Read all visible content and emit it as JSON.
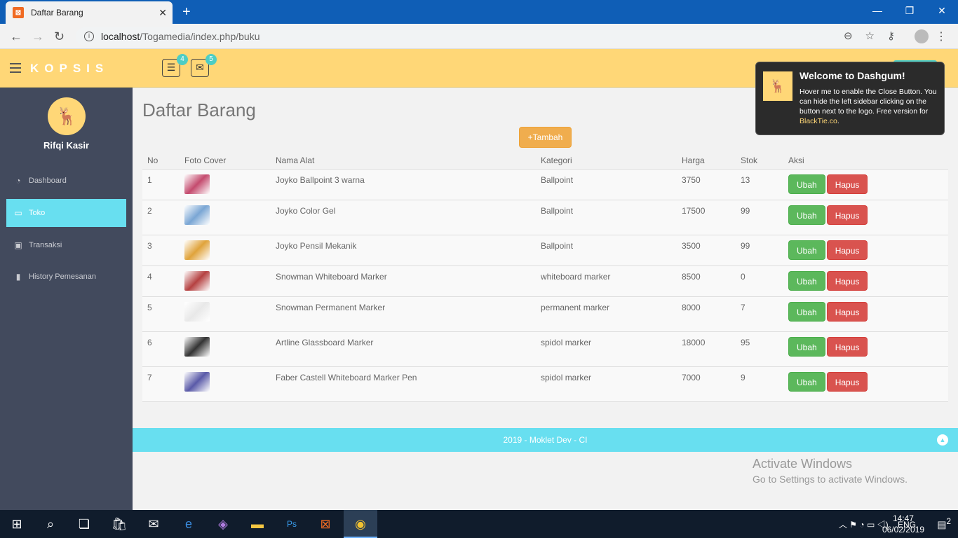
{
  "browser": {
    "tab_title": "Daftar Barang",
    "url_host": "localhost",
    "url_path": "/Togamedia/index.php/buku"
  },
  "header": {
    "logo": "KOPSIS",
    "badge_tasks": "4",
    "badge_mail": "5"
  },
  "sidebar": {
    "username": "Rifqi Kasir",
    "items": [
      {
        "label": "Dashboard",
        "icon": "dashboard-icon"
      },
      {
        "label": "Toko",
        "icon": "desktop-icon"
      },
      {
        "label": "Transaksi",
        "icon": "money-icon"
      },
      {
        "label": "History Pemesanan",
        "icon": "bookmark-icon"
      }
    ]
  },
  "main": {
    "title": "Daftar Barang",
    "add_button": "+Tambah",
    "columns": [
      "No",
      "Foto Cover",
      "Nama Alat",
      "Kategori",
      "Harga",
      "Stok",
      "Aksi"
    ],
    "edit_label": "Ubah",
    "delete_label": "Hapus",
    "rows": [
      {
        "no": "1",
        "nama": "Joyko Ballpoint 3 warna",
        "kategori": "Ballpoint",
        "harga": "3750",
        "stok": "13",
        "thumb": "#c44b6e"
      },
      {
        "no": "2",
        "nama": "Joyko Color Gel",
        "kategori": "Ballpoint",
        "harga": "17500",
        "stok": "99",
        "thumb": "#7aa6d4"
      },
      {
        "no": "3",
        "nama": "Joyko Pensil Mekanik",
        "kategori": "Ballpoint",
        "harga": "3500",
        "stok": "99",
        "thumb": "#e0a33b"
      },
      {
        "no": "4",
        "nama": "Snowman Whiteboard Marker",
        "kategori": "whiteboard marker",
        "harga": "8500",
        "stok": "0",
        "thumb": "#b54141"
      },
      {
        "no": "5",
        "nama": "Snowman Permanent Marker",
        "kategori": "permanent marker",
        "harga": "8000",
        "stok": "7",
        "thumb": "#e8e8e8"
      },
      {
        "no": "6",
        "nama": "Artline Glassboard Marker",
        "kategori": "spidol marker",
        "harga": "18000",
        "stok": "95",
        "thumb": "#333333"
      },
      {
        "no": "7",
        "nama": "Faber Castell Whiteboard Marker Pen",
        "kategori": "spidol marker",
        "harga": "7000",
        "stok": "9",
        "thumb": "#5a5aa8"
      }
    ]
  },
  "footer": {
    "text": "2019 - Moklet Dev - CI"
  },
  "toast": {
    "title": "Welcome to Dashgum!",
    "body": "Hover me to enable the Close Button. You can hide the left sidebar clicking on the button next to the logo. Free version for ",
    "link": "BlackTie.co",
    "end": "."
  },
  "watermark": {
    "line1": "Activate Windows",
    "line2": "Go to Settings to activate Windows."
  },
  "taskbar": {
    "lang": "ENG",
    "time": "14:47",
    "date": "06/02/2019",
    "notif_count": "2"
  },
  "colors": {
    "header": "#ffd777",
    "sidebar": "#424a5d",
    "accent": "#68dff0",
    "success": "#5cb85c",
    "danger": "#d9534f",
    "warning": "#f0ad4e"
  }
}
